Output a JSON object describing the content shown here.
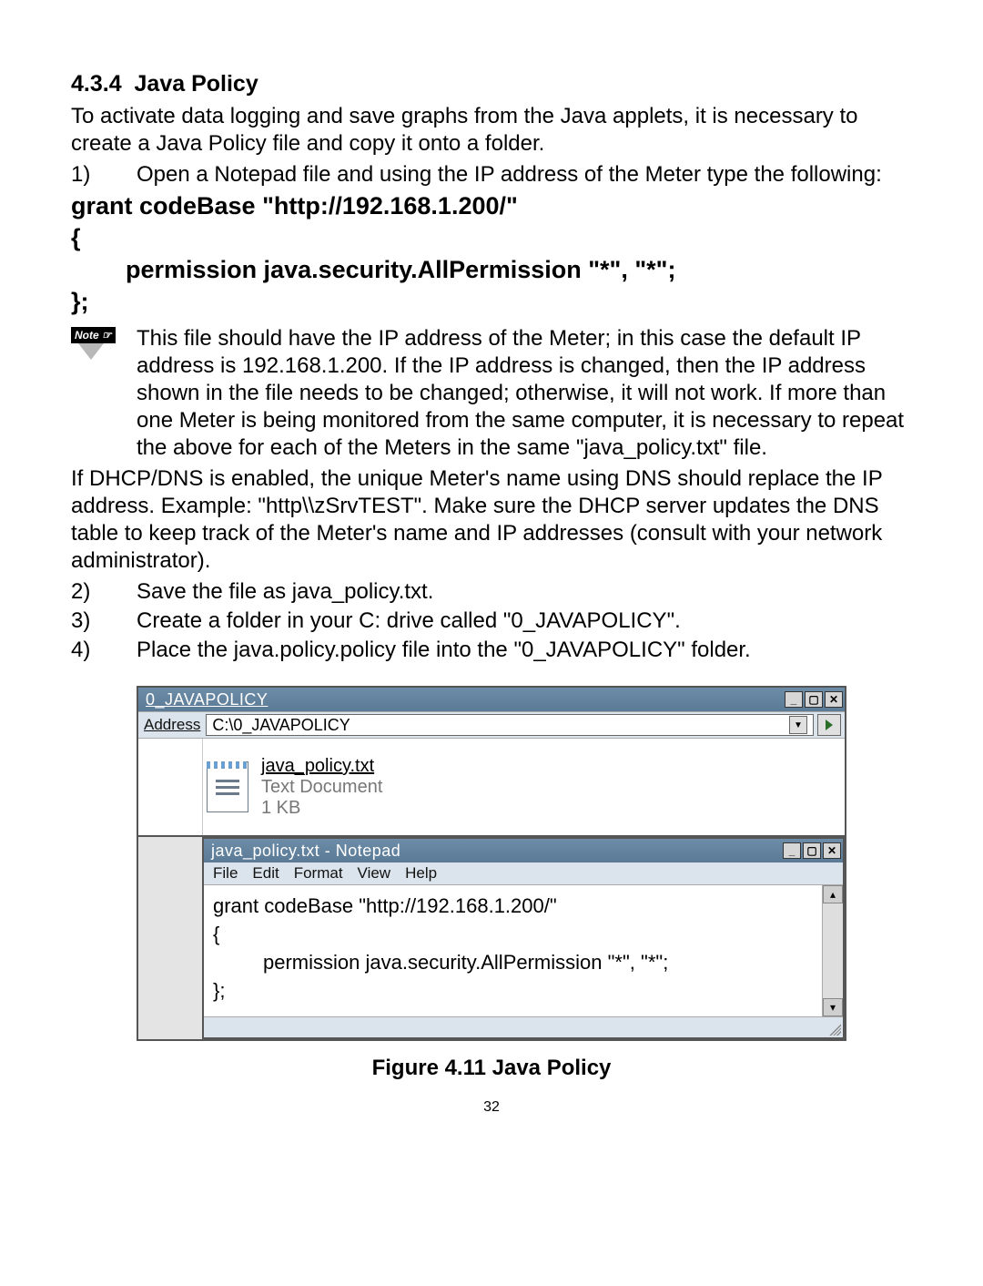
{
  "section": {
    "number": "4.3.4",
    "title": "Java Policy"
  },
  "intro": "To activate data logging and save graphs from the Java applets, it is necessary to create a Java Policy file and copy it onto a folder.",
  "step1": {
    "num": "1)",
    "text": "Open a Notepad file and using the IP address of the Meter type the following:"
  },
  "code_block": "grant codeBase \"http://192.168.1.200/\"\n{\n        permission java.security.AllPermission \"*\", \"*\";\n};",
  "note_label": "Note ☞",
  "note_text": "This file should have the IP address of the Meter; in this case the default IP address is 192.168.1.200. If the IP address is changed, then the IP address shown in the file needs to be changed; otherwise, it will not work. If more than one Meter is being monitored from the same computer, it is necessary to repeat the above for each of the Meters in the same \"java_policy.txt\" file.",
  "dhcp_text": "If DHCP/DNS is enabled, the unique Meter's name using DNS should replace the IP address. Example: \"http\\\\zSrvTEST\".  Make sure the DHCP server updates the DNS table to keep track of the Meter's name and IP addresses (consult with your network administrator).",
  "step2": {
    "num": "2)",
    "text": "Save the file as java_policy.txt."
  },
  "step3": {
    "num": "3)",
    "text": "Create a folder in your C: drive called \"0_JAVAPOLICY\"."
  },
  "step4": {
    "num": "4)",
    "text": "Place the java.policy.policy file into the \"0_JAVAPOLICY\" folder."
  },
  "explorer": {
    "title": "0_JAVAPOLICY",
    "address_label": "Address",
    "address_value": "C:\\0_JAVAPOLICY",
    "file": {
      "name": "java_policy.txt",
      "type": "Text Document",
      "size": "1 KB"
    }
  },
  "notepad": {
    "title": "java_policy.txt  -  Notepad",
    "menu": [
      "File",
      "Edit",
      "Format",
      "View",
      "Help"
    ],
    "content": "grant codeBase \"http://192.168.1.200/\"\n{\n         permission java.security.AllPermission \"*\", \"*\";\n};"
  },
  "figure_caption": "Figure 4.11  Java Policy",
  "page_number": "32"
}
